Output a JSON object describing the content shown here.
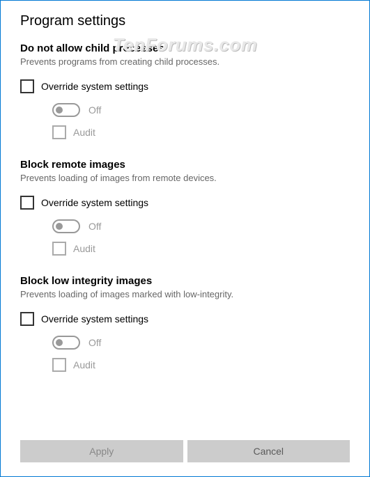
{
  "window_title": "Program settings",
  "watermark": "TenForums.com",
  "sections": [
    {
      "title": "Do not allow child processes",
      "description": "Prevents programs from creating child processes.",
      "override_label": "Override system settings",
      "toggle_state": "Off",
      "audit_label": "Audit"
    },
    {
      "title": "Block remote images",
      "description": "Prevents loading of images from remote devices.",
      "override_label": "Override system settings",
      "toggle_state": "Off",
      "audit_label": "Audit"
    },
    {
      "title": "Block low integrity images",
      "description": "Prevents loading of images marked with low-integrity.",
      "override_label": "Override system settings",
      "toggle_state": "Off",
      "audit_label": "Audit"
    }
  ],
  "buttons": {
    "apply": "Apply",
    "cancel": "Cancel"
  }
}
